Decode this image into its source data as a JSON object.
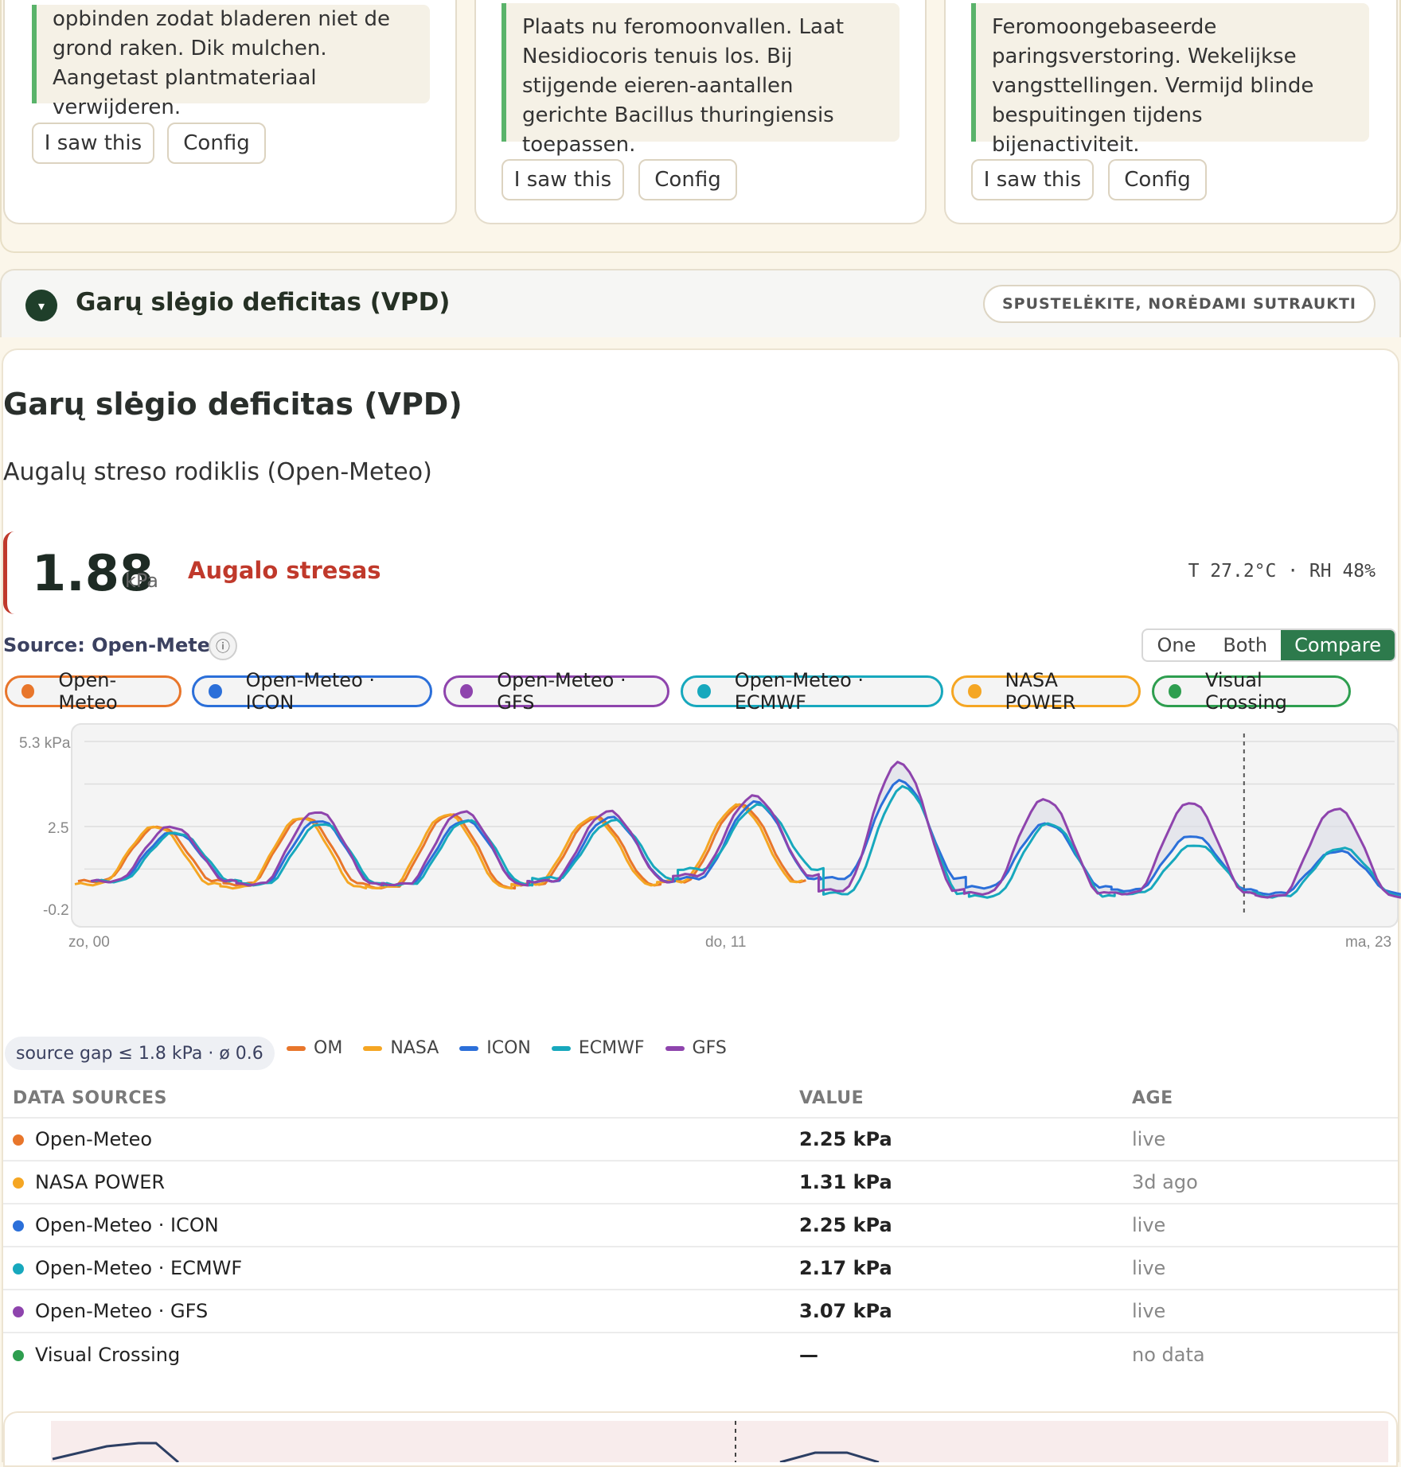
{
  "advisories": [
    {
      "text": "opbinden zodat bladeren niet de grond raken. Dik mulchen. Aangetast plantmateriaal verwijderen.",
      "seen_label": "I saw this",
      "config_label": "Config"
    },
    {
      "text": "Plaats nu feromoonvallen. Laat Nesidiocoris tenuis los. Bij stijgende eieren-aantallen gerichte Bacillus thuringiensis toepassen.",
      "seen_label": "I saw this",
      "config_label": "Config"
    },
    {
      "text": "Feromoongebaseerde paringsverstoring. Wekelijkse vangsttellingen. Vermijd blinde bespuitingen tijdens bijenactiviteit.",
      "seen_label": "I saw this",
      "config_label": "Config"
    }
  ],
  "section": {
    "title": "Garų slėgio deficitas (VPD)",
    "collapse_label": "SPUSTELĖKITE, NORĖDAMI SUTRAUKTI",
    "chevron": "▾"
  },
  "panel": {
    "title": "Garų slėgio deficitas (VPD)",
    "subtitle": "Augalų streso rodiklis (Open-Meteo)",
    "value": "1.88",
    "unit": "kPa",
    "status": "Augalo stresas",
    "status_color": "#c0392b",
    "meta": "T 27.2°C · RH 48%",
    "source": "Source: Open-Meteo",
    "info_icon": "ⓘ",
    "modes": [
      "One",
      "Both",
      "Compare"
    ],
    "active_mode": "Compare"
  },
  "chips": [
    {
      "label": "Open-Meteo",
      "color": "#e8762b"
    },
    {
      "label": "Open-Meteo · ICON",
      "color": "#2b6fd9"
    },
    {
      "label": "Open-Meteo · GFS",
      "color": "#8e44ad"
    },
    {
      "label": "Open-Meteo · ECMWF",
      "color": "#17a8bd"
    },
    {
      "label": "NASA POWER",
      "color": "#f5a623"
    },
    {
      "label": "Visual Crossing",
      "color": "#2e9e4f"
    }
  ],
  "chart_data": {
    "type": "line",
    "ylabel": "kPa",
    "y_ticks": [
      "5.3 kPa",
      "2.5",
      "-0.2"
    ],
    "ylim": [
      -0.2,
      5.3
    ],
    "x_ticks": [
      "zo, 00",
      "do, 11",
      "ma, 23"
    ],
    "now_marker_fraction": 0.8,
    "series": [
      {
        "name": "OM",
        "color": "#e8762b",
        "peaks": [
          2.5,
          2.8,
          2.9,
          2.8,
          3.2
        ],
        "mins": [
          0.7,
          0.6,
          0.5,
          0.6,
          0.7
        ]
      },
      {
        "name": "NASA",
        "color": "#f5a623",
        "peaks": [
          2.5,
          2.8,
          2.9,
          2.8,
          3.2
        ],
        "mins": [
          0.6,
          0.5,
          0.5,
          0.6,
          0.7
        ]
      },
      {
        "name": "ICON",
        "color": "#2b6fd9",
        "peaks": [
          2.3,
          2.7,
          2.7,
          2.8,
          3.3,
          4.0,
          2.6,
          2.2,
          1.7
        ],
        "mins": [
          0.7,
          0.6,
          0.6,
          0.7,
          0.8,
          0.8,
          0.5,
          0.4,
          0.3
        ]
      },
      {
        "name": "ECMWF",
        "color": "#17a8bd",
        "peaks": [
          2.3,
          2.6,
          2.7,
          2.7,
          3.2,
          3.8,
          2.6,
          1.9,
          1.8
        ],
        "mins": [
          0.7,
          0.6,
          0.6,
          0.8,
          1.1,
          0.3,
          0.2,
          0.3,
          0.2
        ]
      },
      {
        "name": "GFS",
        "color": "#8e44ad",
        "peaks": [
          2.5,
          3.0,
          3.0,
          3.0,
          3.5,
          4.6,
          3.4,
          3.3,
          3.1
        ],
        "mins": [
          0.7,
          0.6,
          0.6,
          0.7,
          0.9,
          0.4,
          0.3,
          0.3,
          0.2
        ]
      }
    ]
  },
  "gap_badge": "source gap ≤ 1.8 kPa · ø 0.6",
  "table": {
    "headers": [
      "DATA SOURCES",
      "VALUE",
      "AGE"
    ],
    "rows": [
      {
        "name": "Open-Meteo",
        "color": "#e8762b",
        "value": "2.25 kPa",
        "age": "live"
      },
      {
        "name": "NASA POWER",
        "color": "#f5a623",
        "value": "1.31 kPa",
        "age": "3d ago"
      },
      {
        "name": "Open-Meteo · ICON",
        "color": "#2b6fd9",
        "value": "2.25 kPa",
        "age": "live"
      },
      {
        "name": "Open-Meteo · ECMWF",
        "color": "#17a8bd",
        "value": "2.17 kPa",
        "age": "live"
      },
      {
        "name": "Open-Meteo · GFS",
        "color": "#8e44ad",
        "value": "3.07 kPa",
        "age": "live"
      },
      {
        "name": "Visual Crossing",
        "color": "#2e9e4f",
        "value": "—",
        "age": "no data"
      }
    ]
  }
}
